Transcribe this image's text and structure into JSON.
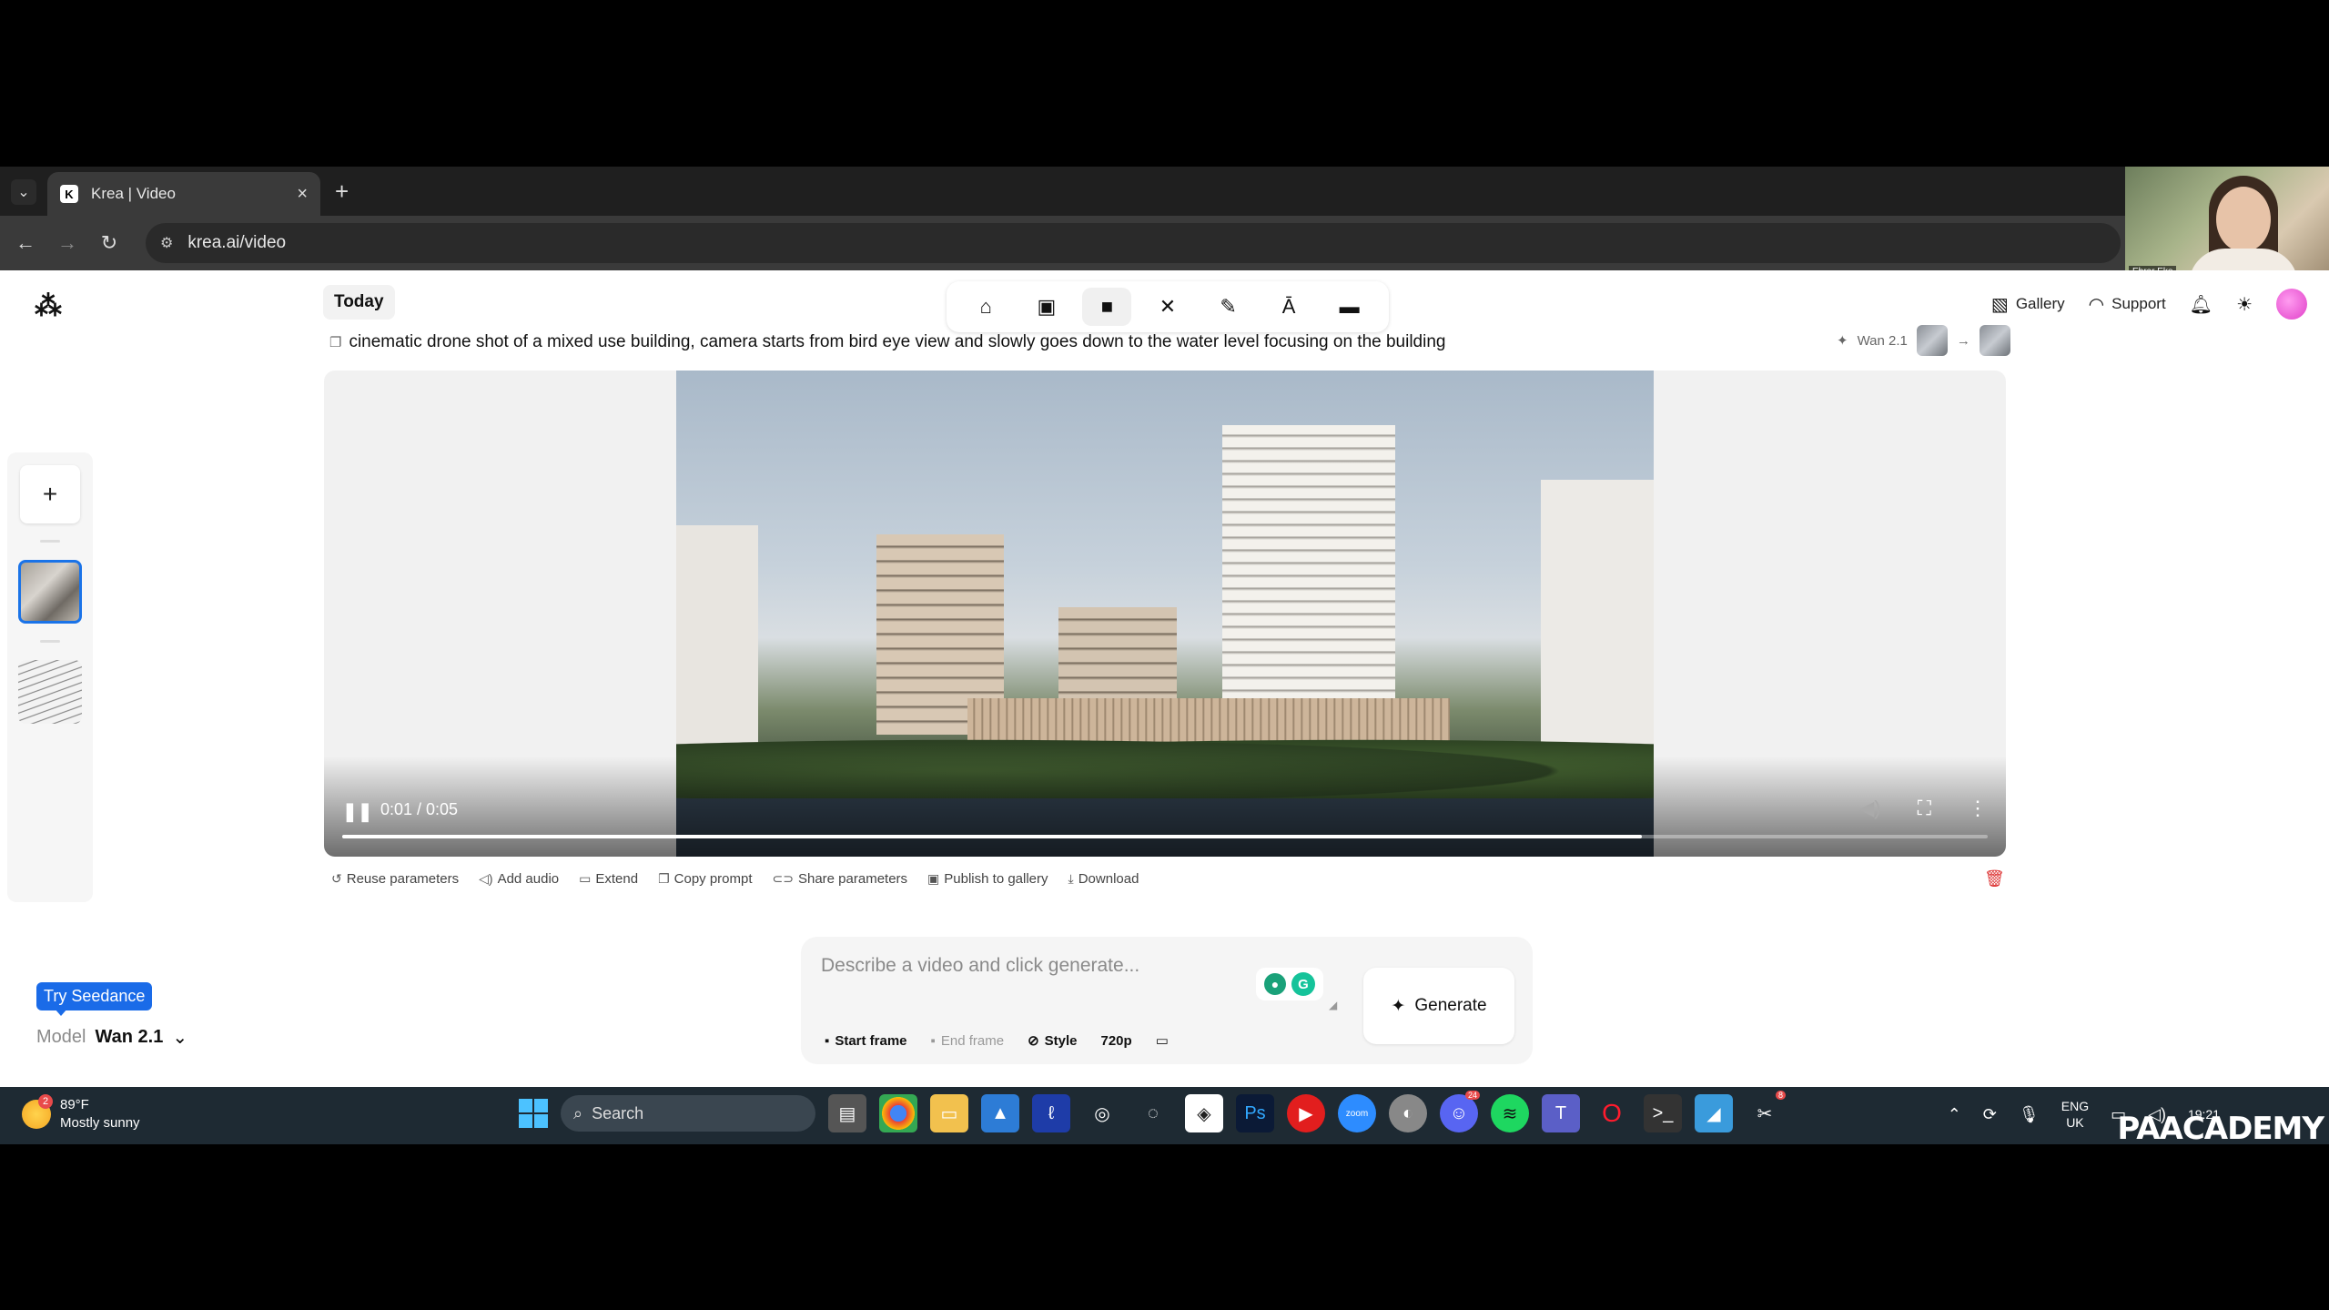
{
  "browser": {
    "tab_title": "Krea | Video",
    "url": "krea.ai/video"
  },
  "webcam": {
    "name": "Ebrar Eke"
  },
  "header": {
    "today_label": "Today",
    "gallery_label": "Gallery",
    "support_label": "Support",
    "toolbar_icons": [
      "home-icon",
      "image-icon",
      "video-icon",
      "enhance-icon",
      "edit-icon",
      "train-icon",
      "folder-icon"
    ],
    "active_tool": "video-icon"
  },
  "generation": {
    "prompt": "cinematic drone shot of a mixed use building, camera starts from bird eye view and slowly goes down to the water level focusing on the building",
    "model_tag": "Wan 2.1"
  },
  "player": {
    "time": "0:01 / 0:05",
    "progress": 0.79
  },
  "actions": {
    "reuse": "Reuse parameters",
    "add_audio": "Add audio",
    "extend": "Extend",
    "copy_prompt": "Copy prompt",
    "share": "Share parameters",
    "publish": "Publish to gallery",
    "download": "Download"
  },
  "composer": {
    "placeholder": "Describe a video and click generate...",
    "generate_label": "Generate",
    "start_frame": "Start frame",
    "end_frame": "End frame",
    "style": "Style",
    "resolution": "720p"
  },
  "sidebar": {
    "try_label": "Try Seedance",
    "model_label": "Model",
    "model_value": "Wan 2.1"
  },
  "taskbar": {
    "weather_temp": "89°F",
    "weather_desc": "Mostly sunny",
    "weather_badge": "2",
    "search_label": "Search",
    "lang_1": "ENG",
    "lang_2": "UK",
    "time": "19:21",
    "discord_badge": "24",
    "app_badge": "8"
  },
  "watermark": "PAACADEMY"
}
